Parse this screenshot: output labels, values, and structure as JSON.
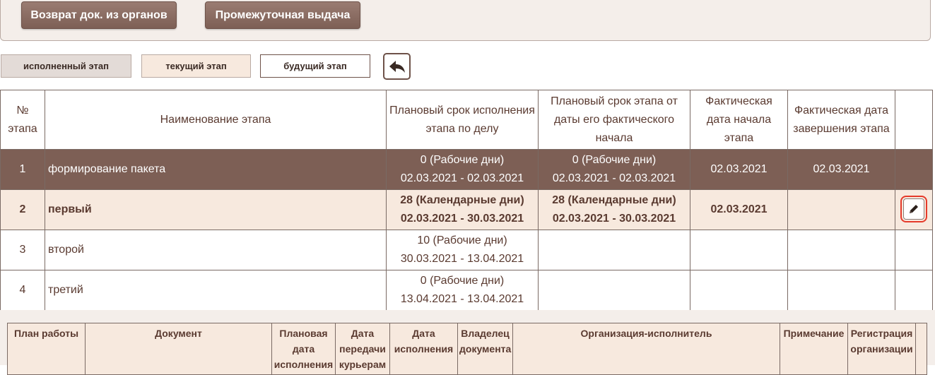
{
  "top_buttons": {
    "return_docs": "Возврат док. из органов",
    "interim_issue": "Промежуточная выдача"
  },
  "legend": {
    "done": "исполненный этап",
    "current": "текущий этап",
    "future": "будущий этап"
  },
  "stages_table": {
    "headers": {
      "num": "№ этапа",
      "name": "Наименование этапа",
      "plan_case": "Плановый срок исполнения этапа по делу",
      "plan_actual": "Плановый срок этапа от даты его фактического начала",
      "actual_start": "Фактическая дата начала этапа",
      "actual_end": "Фактическая дата завершения этапа"
    },
    "rows": [
      {
        "num": "1",
        "name": "формирование пакета",
        "plan_case_days": "0 (Рабочие дни)",
        "plan_case_range": "02.03.2021 - 02.03.2021",
        "plan_actual_days": "0 (Рабочие дни)",
        "plan_actual_range": "02.03.2021 - 02.03.2021",
        "actual_start": "02.03.2021",
        "actual_end": "02.03.2021"
      },
      {
        "num": "2",
        "name": "первый",
        "plan_case_days": "28 (Календарные дни)",
        "plan_case_range": "02.03.2021 - 30.03.2021",
        "plan_actual_days": "28 (Календарные дни)",
        "plan_actual_range": "02.03.2021 - 30.03.2021",
        "actual_start": "02.03.2021",
        "actual_end": ""
      },
      {
        "num": "3",
        "name": "второй",
        "plan_case_days": "10 (Рабочие дни)",
        "plan_case_range": "30.03.2021 - 13.04.2021",
        "plan_actual_days": "",
        "plan_actual_range": "",
        "actual_start": "",
        "actual_end": ""
      },
      {
        "num": "4",
        "name": "третий",
        "plan_case_days": "0 (Рабочие дни)",
        "plan_case_range": "13.04.2021 - 13.04.2021",
        "plan_actual_days": "",
        "plan_actual_range": "",
        "actual_start": "",
        "actual_end": ""
      }
    ]
  },
  "plan_table": {
    "headers": [
      "План работы",
      "Документ",
      "Плановая дата исполнения",
      "Дата передачи курьерам",
      "Дата исполнения",
      "Владелец документа",
      "Организация-исполнитель",
      "Примечание",
      "Регистрация организации"
    ]
  },
  "icons": {
    "back": "arrow-left-icon",
    "edit": "pencil-icon"
  },
  "colors": {
    "done_row": "#7d5f55",
    "current_row": "#f7e9de",
    "future_row": "#ffffff",
    "highlight": "#e53a2a"
  }
}
